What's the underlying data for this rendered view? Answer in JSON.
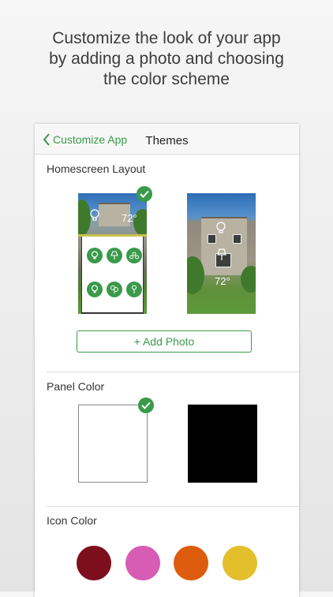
{
  "promo": {
    "line1": "Customize the look of your app",
    "line2": "by adding a photo and choosing",
    "line3": "the color scheme"
  },
  "navbar": {
    "back_label": "Customize App",
    "title": "Themes"
  },
  "homescreen_layout": {
    "title": "Homescreen Layout",
    "options": [
      {
        "name": "panel-layout",
        "temperature": "72°",
        "selected": true
      },
      {
        "name": "photo-layout",
        "temperature": "72°",
        "selected": false
      }
    ],
    "add_photo_label": "+ Add Photo"
  },
  "panel_color": {
    "title": "Panel Color",
    "options": [
      {
        "name": "white",
        "color": "#ffffff",
        "selected": true
      },
      {
        "name": "black",
        "color": "#000000",
        "selected": false
      }
    ]
  },
  "icon_color": {
    "title": "Icon Color",
    "options": [
      "#7d0f1d",
      "#d75cb3",
      "#dd5c0d",
      "#e3bf2c"
    ]
  },
  "colors": {
    "accent": "#3a9a4a"
  }
}
